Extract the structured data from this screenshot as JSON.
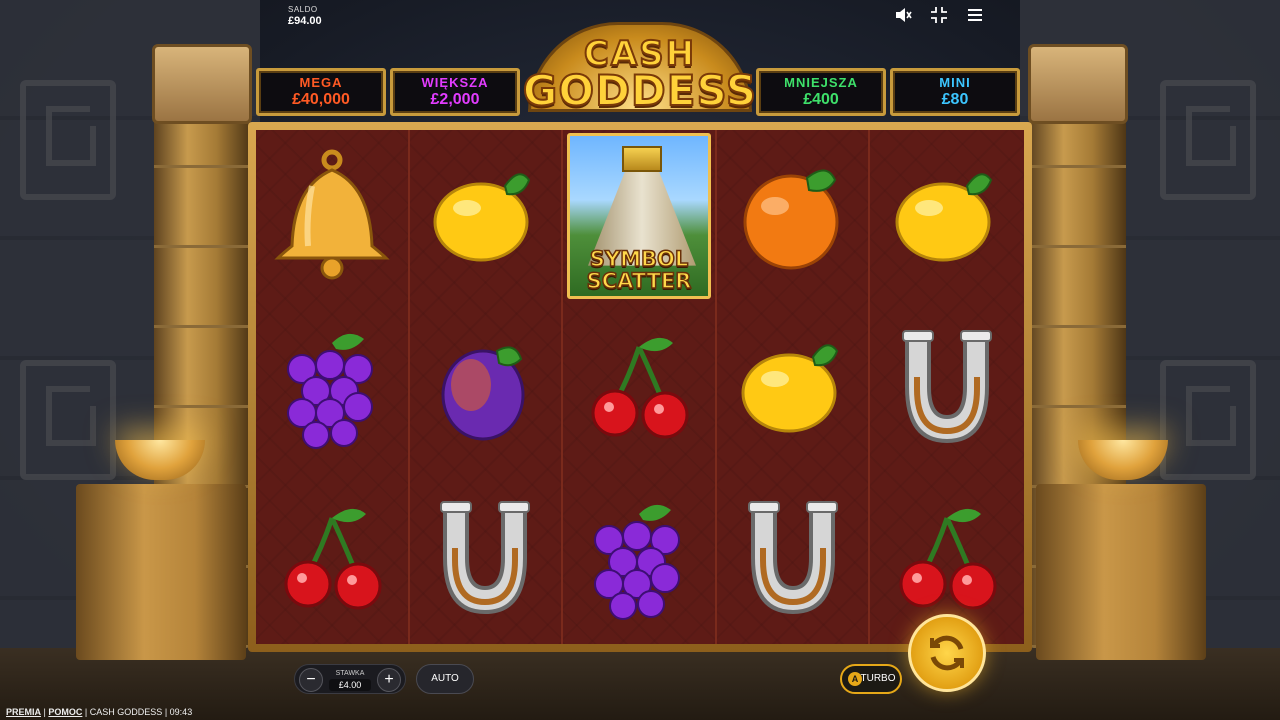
{
  "balance": {
    "label": "SALDO",
    "value": "£94.00"
  },
  "top_icons": [
    "mute-icon",
    "fullscreen-exit-icon",
    "menu-icon"
  ],
  "logo": {
    "line1": "CASH",
    "line2": "GODDESS"
  },
  "jackpots": [
    {
      "name": "MEGA",
      "value": "£40,000",
      "color": "#ff5a24"
    },
    {
      "name": "WIĘKSZA",
      "value": "£2,000",
      "color": "#e23cff"
    },
    {
      "name": "MNIEJSZA",
      "value": "£400",
      "color": "#3ee06a"
    },
    {
      "name": "MINI",
      "value": "£80",
      "color": "#3cc6ff"
    }
  ],
  "reels": [
    [
      "bell",
      "grapes",
      "cherry"
    ],
    [
      "lemon",
      "plum",
      "horseshoe"
    ],
    [
      "scatter",
      "cherry",
      "grapes"
    ],
    [
      "orange",
      "lemon",
      "horseshoe"
    ],
    [
      "lemon",
      "horseshoe",
      "cherry"
    ]
  ],
  "scatter": {
    "line1": "SYMBOL",
    "line2": "SCATTER"
  },
  "bet": {
    "label": "STAWKA",
    "value": "£4.00",
    "minus": "−",
    "plus": "+"
  },
  "auto_label": "AUTO",
  "turbo_label": "TURBO",
  "footer": {
    "link1": "PREMIA",
    "sep": "|",
    "link2": "POMOC",
    "game": "CASH GODDESS",
    "time": "09:43"
  }
}
